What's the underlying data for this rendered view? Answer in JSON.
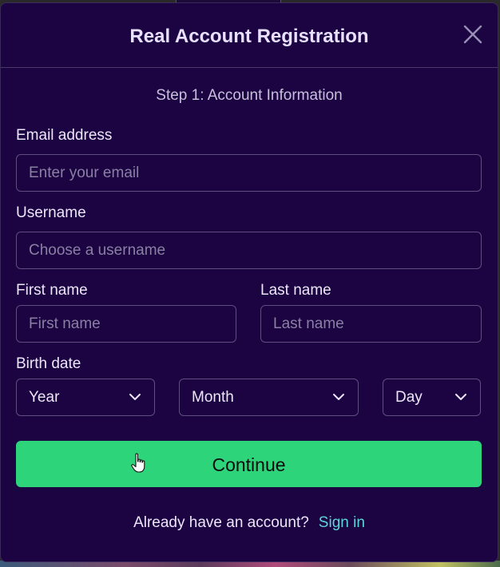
{
  "modal": {
    "title": "Real Account Registration",
    "step_label": "Step 1: Account Information"
  },
  "form": {
    "email": {
      "label": "Email address",
      "placeholder": "Enter your email",
      "value": ""
    },
    "username": {
      "label": "Username",
      "placeholder": "Choose a username",
      "value": ""
    },
    "first_name": {
      "label": "First name",
      "placeholder": "First name",
      "value": ""
    },
    "last_name": {
      "label": "Last name",
      "placeholder": "Last name",
      "value": ""
    },
    "birth_date": {
      "label": "Birth date",
      "year": "Year",
      "month": "Month",
      "day": "Day"
    },
    "continue_label": "Continue"
  },
  "footer": {
    "prompt": "Already have an account?",
    "signin_label": "Sign in"
  },
  "colors": {
    "background": "#1c0342",
    "accent_button": "#2ed47a",
    "link": "#5ed4d8"
  },
  "icons": [
    "close-icon",
    "chevron-down-icon",
    "pointer-cursor-icon"
  ]
}
